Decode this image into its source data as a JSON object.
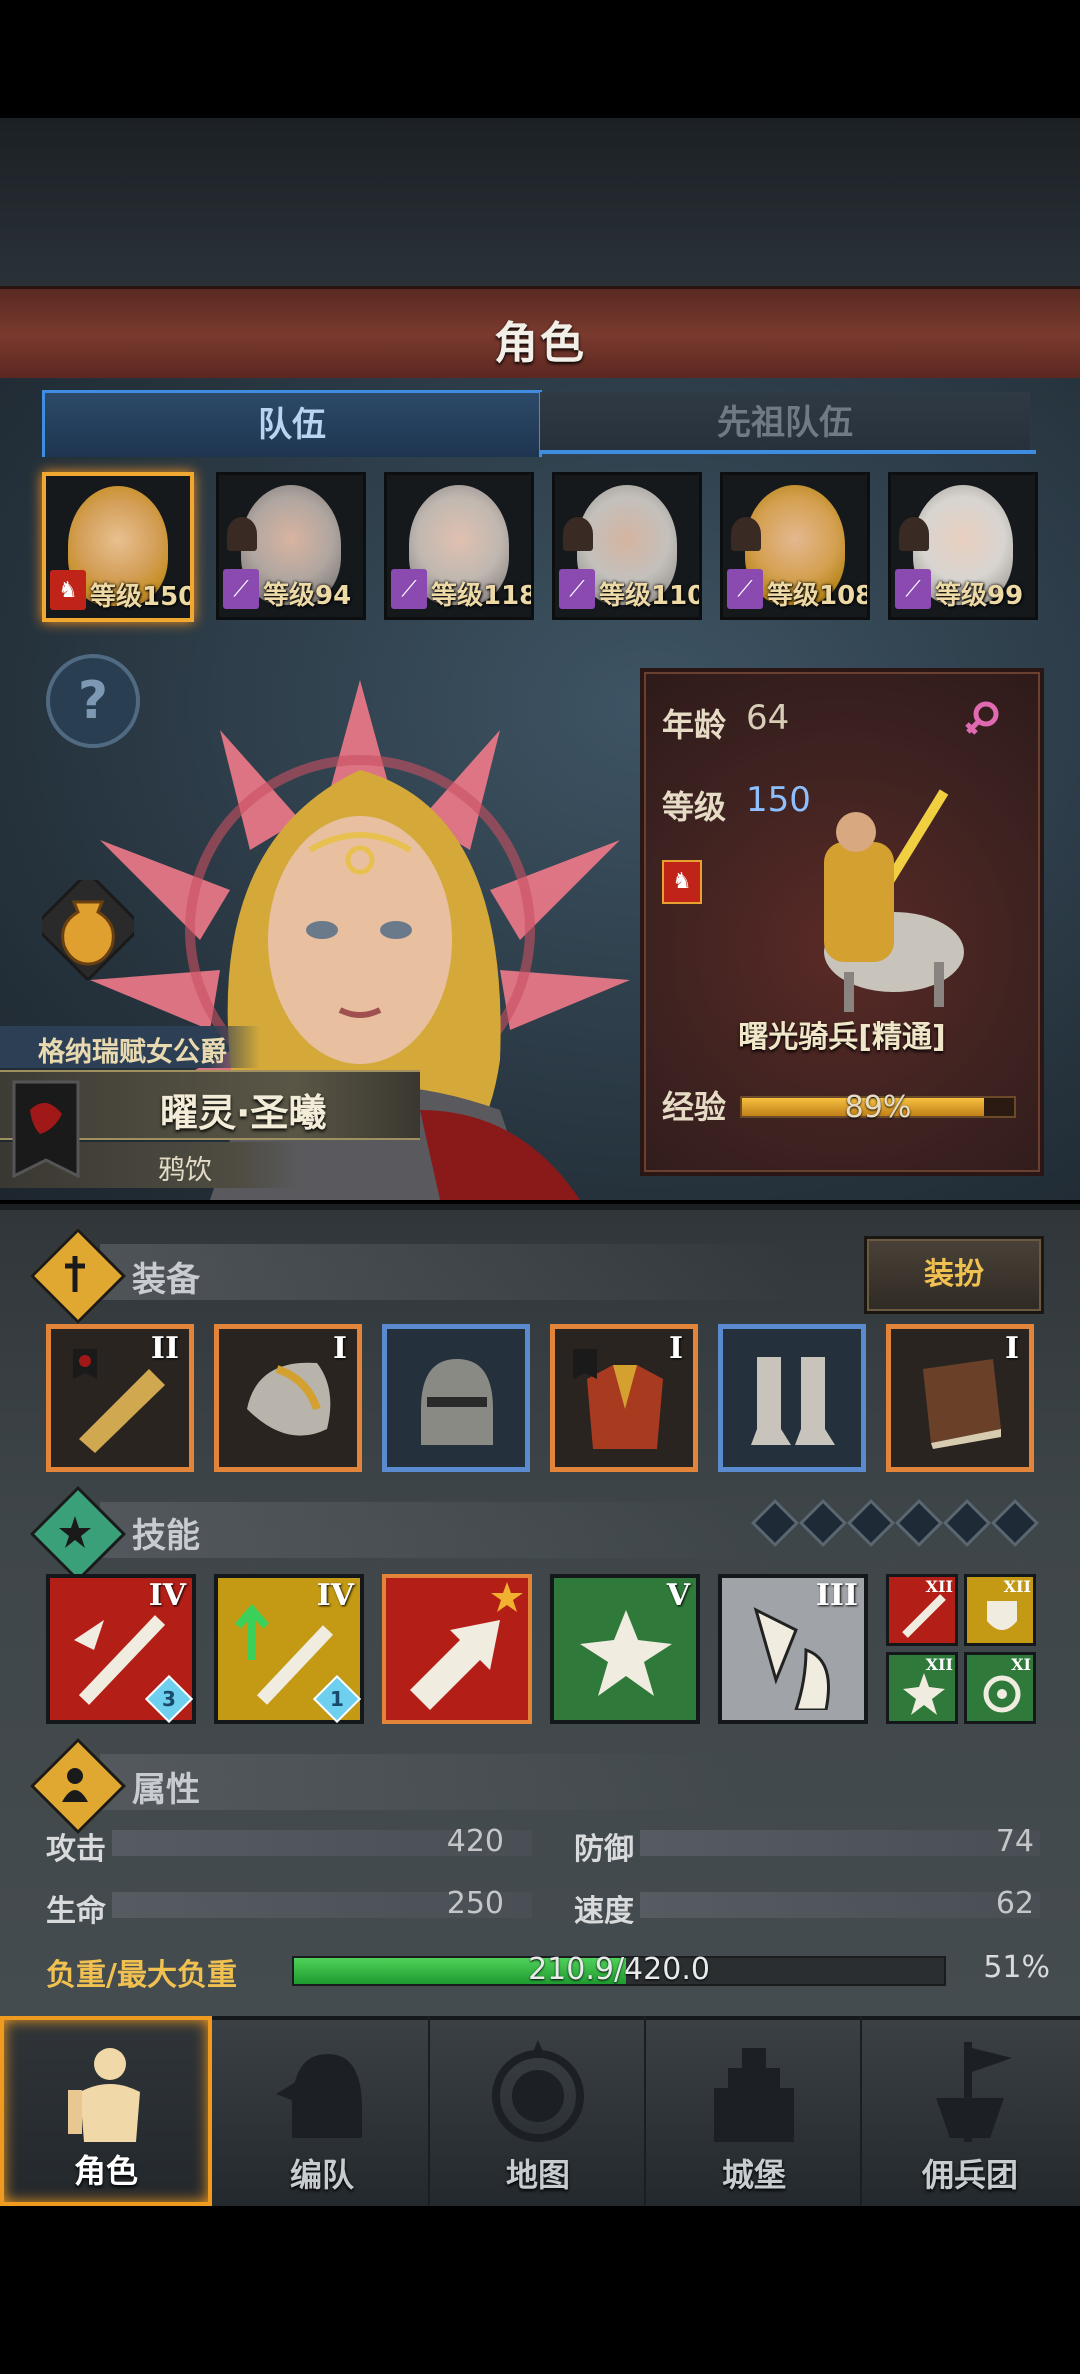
{
  "header": {
    "title": "角色"
  },
  "tabs": [
    {
      "label": "队伍"
    },
    {
      "label": "先祖队伍"
    }
  ],
  "party": [
    {
      "level_text": "等级150",
      "class_color": "#c02418",
      "selected": true
    },
    {
      "level_text": "等级94",
      "class_color": "#8a4ab0",
      "selected": false
    },
    {
      "level_text": "等级118",
      "class_color": "#8a4ab0",
      "selected": false
    },
    {
      "level_text": "等级110",
      "class_color": "#8a4ab0",
      "selected": false
    },
    {
      "level_text": "等级108",
      "class_color": "#8a4ab0",
      "selected": false
    },
    {
      "level_text": "等级99",
      "class_color": "#8a4ab0",
      "selected": false
    }
  ],
  "help": {
    "icon": "question-icon",
    "text": "?"
  },
  "hero": {
    "title": "格纳瑞赋女公爵",
    "name": "曜灵·圣曦",
    "subtitle": "鸦饮"
  },
  "info": {
    "age_label": "年龄",
    "age_value": "64",
    "gender_icon": "female-icon",
    "level_label": "等级",
    "level_value": "150",
    "class_name": "曙光骑兵[精通]",
    "exp_label": "经验",
    "exp_percent_text": "89%",
    "exp_fraction": 0.89
  },
  "equipment": {
    "title": "装备",
    "dress_button": "装扮",
    "items": [
      {
        "tier": "II",
        "name": "weapon-icon",
        "rarity": "orange"
      },
      {
        "tier": "I",
        "name": "shoulder-armor-icon",
        "rarity": "orange"
      },
      {
        "tier": "",
        "name": "helmet-icon",
        "rarity": "blue"
      },
      {
        "tier": "I",
        "name": "chest-armor-icon",
        "rarity": "orange"
      },
      {
        "tier": "",
        "name": "boots-icon",
        "rarity": "blue"
      },
      {
        "tier": "I",
        "name": "book-icon",
        "rarity": "orange"
      }
    ]
  },
  "skills": {
    "title": "技能",
    "items": [
      {
        "tier": "IV",
        "badge": "3",
        "bg": "#b31f17"
      },
      {
        "tier": "IV",
        "badge": "1",
        "bg": "#c49a14"
      },
      {
        "tier": "",
        "badge": "",
        "bg": "#b31f17"
      },
      {
        "tier": "V",
        "badge": "",
        "bg": "#2f7a3a"
      },
      {
        "tier": "III",
        "badge": "",
        "bg": "#a0a4a8"
      }
    ],
    "small": [
      {
        "tier": "XII",
        "bg": "#b31f17"
      },
      {
        "tier": "XII",
        "bg": "#c49a14"
      },
      {
        "tier": "XII",
        "bg": "#2f7a3a"
      },
      {
        "tier": "XI",
        "bg": "#2f7a3a"
      }
    ]
  },
  "attributes": {
    "title": "属性",
    "attack_label": "攻击",
    "attack_value": "420",
    "defense_label": "防御",
    "defense_value": "74",
    "hp_label": "生命",
    "hp_value": "250",
    "speed_label": "速度",
    "speed_value": "62",
    "load_label": "负重/最大负重",
    "load_text": "210.9/420.0",
    "load_percent_text": "51%",
    "load_fraction": 0.51
  },
  "nav": [
    {
      "label": "角色",
      "icon": "knight-icon",
      "selected": true
    },
    {
      "label": "编队",
      "icon": "helmet-icon",
      "selected": false
    },
    {
      "label": "地图",
      "icon": "compass-map-icon",
      "selected": false
    },
    {
      "label": "城堡",
      "icon": "castle-icon",
      "selected": false
    },
    {
      "label": "佣兵团",
      "icon": "mercenary-flag-icon",
      "selected": false
    }
  ]
}
